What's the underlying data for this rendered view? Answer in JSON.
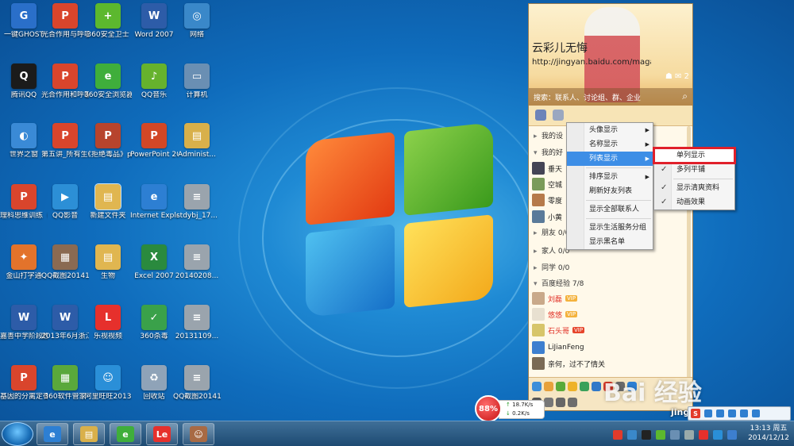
{
  "desktop": {
    "icons": [
      {
        "label": "一键GHOST",
        "glyph": "G",
        "color": "#2a6fc9"
      },
      {
        "label": "光合作用与呼吸作用...",
        "glyph": "P",
        "color": "#d9452c"
      },
      {
        "label": "360安全卫士",
        "glyph": "+",
        "color": "#5cb82e"
      },
      {
        "label": "Word 2007",
        "glyph": "W",
        "color": "#2d5ca8"
      },
      {
        "label": "网络",
        "glyph": "◎",
        "color": "#3a88c9"
      },
      {
        "label": "腾讯QQ",
        "glyph": "Q",
        "color": "#1b1b1b"
      },
      {
        "label": "光合作用和呼吸作用专...",
        "glyph": "P",
        "color": "#d9452c"
      },
      {
        "label": "360安全浏览器7",
        "glyph": "e",
        "color": "#3fae3b"
      },
      {
        "label": "QQ音乐",
        "glyph": "♪",
        "color": "#66b22d"
      },
      {
        "label": "计算机",
        "glyph": "▭",
        "color": "#6a8fb3"
      },
      {
        "label": "世界之窗",
        "glyph": "◐",
        "color": "#3a8ad6"
      },
      {
        "label": "第五讲_所有生命都需...",
        "glyph": "P",
        "color": "#d9452c"
      },
      {
        "label": "《拒绝毒品》ppt课...",
        "glyph": "P",
        "color": "#b7442d"
      },
      {
        "label": "PowerPoint 2007",
        "glyph": "P",
        "color": "#d24726"
      },
      {
        "label": "Administ...",
        "glyph": "▤",
        "color": "#d8b04a"
      },
      {
        "label": "理科思维训练（一）...",
        "glyph": "P",
        "color": "#d9452c"
      },
      {
        "label": "QQ影音",
        "glyph": "▶",
        "color": "#2c8fd6"
      },
      {
        "label": "新建文件夹",
        "glyph": "▤",
        "color": "#e0b650"
      },
      {
        "label": "Internet Explorer",
        "glyph": "e",
        "color": "#2d7fd3"
      },
      {
        "label": "stdybj_17...",
        "glyph": "≡",
        "color": "#9aa4ad"
      },
      {
        "label": "金山打字通",
        "glyph": "✦",
        "color": "#e3732b"
      },
      {
        "label": "QQ截图20141208...",
        "glyph": "▦",
        "color": "#8a6a52"
      },
      {
        "label": "生物",
        "glyph": "▤",
        "color": "#e0b650"
      },
      {
        "label": "Excel 2007",
        "glyph": "X",
        "color": "#2a8a3e"
      },
      {
        "label": "20140208...",
        "glyph": "≡",
        "color": "#9aa4ad"
      },
      {
        "label": "嘉善中学阶段性考试...",
        "glyph": "W",
        "color": "#2d5ca8"
      },
      {
        "label": "2013年6月浙江省普通高...",
        "glyph": "W",
        "color": "#2d5ca8"
      },
      {
        "label": "乐视视频",
        "glyph": "L",
        "color": "#e6302c"
      },
      {
        "label": "360杀毒",
        "glyph": "✓",
        "color": "#3aa14a"
      },
      {
        "label": "20131109...",
        "glyph": "≡",
        "color": "#9aa4ad"
      },
      {
        "label": "基因的分离定律(第一...",
        "glyph": "P",
        "color": "#d9452c"
      },
      {
        "label": "360软件管家",
        "glyph": "▦",
        "color": "#5aa83b"
      },
      {
        "label": "阿里旺旺2013",
        "glyph": "☺",
        "color": "#2a8fd8"
      },
      {
        "label": "回收站",
        "glyph": "♻",
        "color": "#8fa3b8"
      },
      {
        "label": "QQ截图20141211...",
        "glyph": "≡",
        "color": "#9aa4ad"
      }
    ]
  },
  "qq": {
    "nickname": "云彩儿无悔",
    "signature": "http://jingyan.baidu.com/magaz...",
    "badge_count": "2",
    "search_placeholder": "搜索：联系人、讨论组、群、企业",
    "groups": [
      {
        "label": "我的设",
        "arrow": "▸"
      },
      {
        "label": "我的好",
        "arrow": "▾"
      },
      {
        "label": "朋友 0/0",
        "arrow": "▸"
      },
      {
        "label": "家人 0/0",
        "arrow": "▸"
      },
      {
        "label": "同学 0/0",
        "arrow": "▸"
      },
      {
        "label": "百度经验 7/8",
        "arrow": "▾"
      }
    ],
    "friends_top": [
      {
        "name": "垂天"
      },
      {
        "name": "空城"
      },
      {
        "name": "零度"
      },
      {
        "name": "小黄"
      }
    ],
    "friends_bottom": [
      {
        "name": "刘磊",
        "style": "red",
        "vip": "VIP"
      },
      {
        "name": "悠悠",
        "style": "red",
        "vip": "VIP"
      },
      {
        "name": "石头哥",
        "style": "red",
        "vip": "VIP"
      },
      {
        "name": "LiJianFeng",
        "style": "blk",
        "vip": ""
      },
      {
        "name": "亲何，过不了情关",
        "style": "blk",
        "vip": ""
      }
    ]
  },
  "menu1": {
    "items": [
      "头像显示",
      "名称显示",
      "列表显示",
      "排序显示",
      "刷新好友列表",
      "显示全部联系人",
      "显示生活服务分组",
      "显示黑名单"
    ]
  },
  "menu2": {
    "items": [
      "单列显示",
      "多列平铺",
      "显示清爽资料",
      "动画效果"
    ]
  },
  "speed": {
    "percent": "88%",
    "up": "18.7K/s",
    "down": "0.2K/s"
  },
  "watermark": {
    "text": "Bai 经验",
    "url": "jingyan.baidu.com"
  },
  "taskbar": {
    "time": "13:13 周五",
    "date": "2014/12/12",
    "apps": [
      {
        "glyph": "e",
        "color": "#2d7fd3"
      },
      {
        "glyph": "▤",
        "color": "#d9b04a"
      },
      {
        "glyph": "e",
        "color": "#3fae3b"
      },
      {
        "glyph": "Le",
        "color": "#e6302c"
      },
      {
        "glyph": "☺",
        "color": "#a86a44"
      }
    ]
  }
}
